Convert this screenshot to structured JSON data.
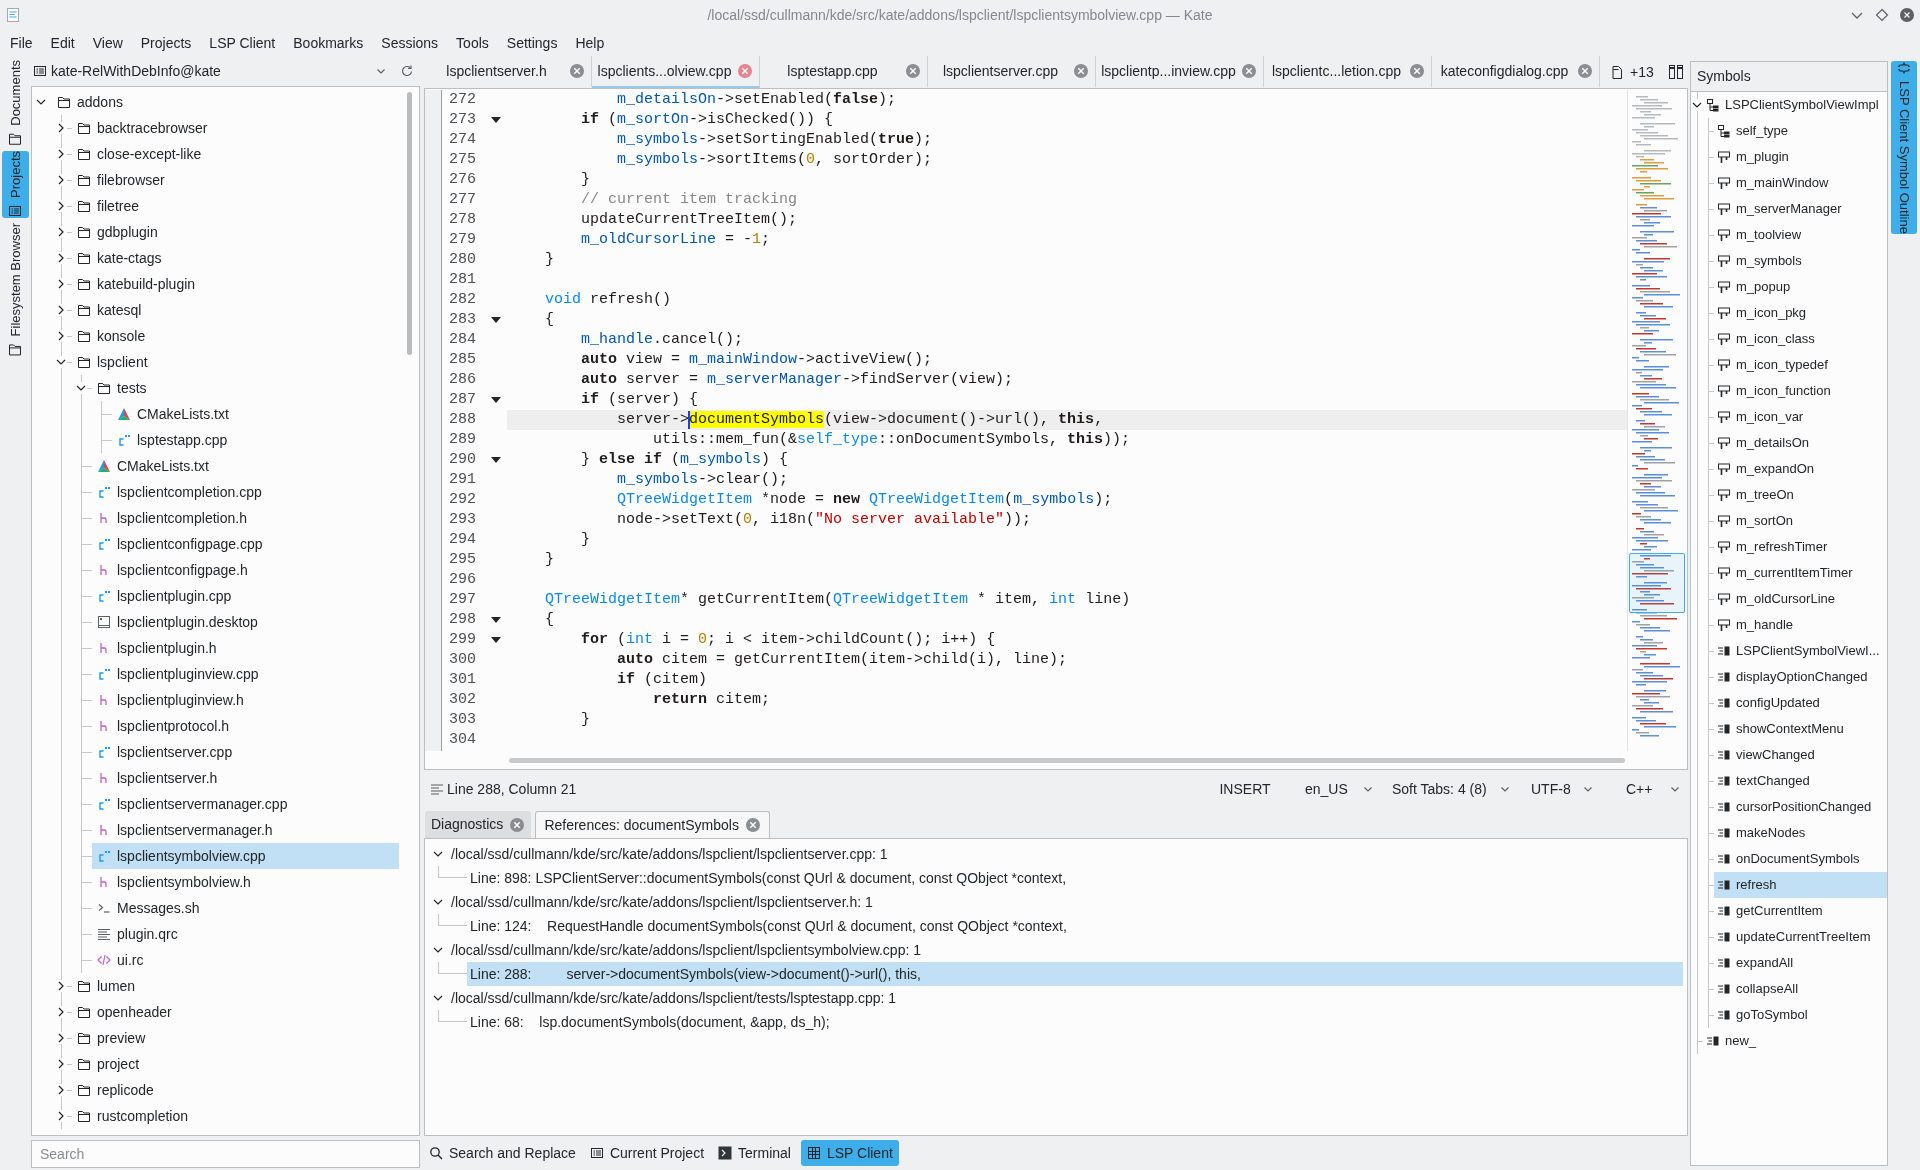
{
  "window": {
    "title": "/local/ssd/cullmann/kde/src/kate/addons/lspclient/lspclientsymbolview.cpp — Kate"
  },
  "menu_bar": [
    "File",
    "Edit",
    "View",
    "Projects",
    "LSP Client",
    "Bookmarks",
    "Sessions",
    "Tools",
    "Settings",
    "Help"
  ],
  "left_sidebar": [
    {
      "label": "Documents",
      "kind": "folder",
      "selected": false
    },
    {
      "label": "Projects",
      "kind": "list",
      "selected": true
    },
    {
      "label": "Filesystem Browser",
      "kind": "folder",
      "selected": false
    }
  ],
  "project_panel": {
    "project": "kate-RelWithDebInfo@kate",
    "tree": [
      {
        "label": "addons",
        "kind": "folder",
        "expanded": true,
        "selected": false,
        "children": [
          {
            "label": "backtracebrowser",
            "kind": "folder",
            "expanded": false,
            "selected": false
          },
          {
            "label": "close-except-like",
            "kind": "folder",
            "expanded": false,
            "selected": false
          },
          {
            "label": "filebrowser",
            "kind": "folder",
            "expanded": false,
            "selected": false
          },
          {
            "label": "filetree",
            "kind": "folder",
            "expanded": false,
            "selected": false
          },
          {
            "label": "gdbplugin",
            "kind": "folder",
            "expanded": false,
            "selected": false
          },
          {
            "label": "kate-ctags",
            "kind": "folder",
            "expanded": false,
            "selected": false
          },
          {
            "label": "katebuild-plugin",
            "kind": "folder",
            "expanded": false,
            "selected": false
          },
          {
            "label": "katesql",
            "kind": "folder",
            "expanded": false,
            "selected": false
          },
          {
            "label": "konsole",
            "kind": "folder",
            "expanded": false,
            "selected": false
          },
          {
            "label": "lspclient",
            "kind": "folder",
            "expanded": true,
            "selected": false,
            "children": [
              {
                "label": "tests",
                "kind": "folder",
                "expanded": true,
                "selected": false,
                "children": [
                  {
                    "label": "CMakeLists.txt",
                    "kind": "cmake",
                    "selected": false
                  },
                  {
                    "label": "lsptestapp.cpp",
                    "kind": "cpp",
                    "selected": false
                  }
                ]
              },
              {
                "label": "CMakeLists.txt",
                "kind": "cmake",
                "selected": false
              },
              {
                "label": "lspclientcompletion.cpp",
                "kind": "cpp",
                "selected": false
              },
              {
                "label": "lspclientcompletion.h",
                "kind": "header",
                "selected": false
              },
              {
                "label": "lspclientconfigpage.cpp",
                "kind": "cpp",
                "selected": false
              },
              {
                "label": "lspclientconfigpage.h",
                "kind": "header",
                "selected": false
              },
              {
                "label": "lspclientplugin.cpp",
                "kind": "cpp",
                "selected": false
              },
              {
                "label": "lspclientplugin.desktop",
                "kind": "desktop",
                "selected": false
              },
              {
                "label": "lspclientplugin.h",
                "kind": "header",
                "selected": false
              },
              {
                "label": "lspclientpluginview.cpp",
                "kind": "cpp",
                "selected": false
              },
              {
                "label": "lspclientpluginview.h",
                "kind": "header",
                "selected": false
              },
              {
                "label": "lspclientprotocol.h",
                "kind": "header",
                "selected": false
              },
              {
                "label": "lspclientserver.cpp",
                "kind": "cpp",
                "selected": false
              },
              {
                "label": "lspclientserver.h",
                "kind": "header",
                "selected": false
              },
              {
                "label": "lspclientservermanager.cpp",
                "kind": "cpp",
                "selected": false
              },
              {
                "label": "lspclientservermanager.h",
                "kind": "header",
                "selected": false
              },
              {
                "label": "lspclientsymbolview.cpp",
                "kind": "cpp",
                "selected": true
              },
              {
                "label": "lspclientsymbolview.h",
                "kind": "header",
                "selected": false
              },
              {
                "label": "Messages.sh",
                "kind": "shell",
                "selected": false
              },
              {
                "label": "plugin.qrc",
                "kind": "text",
                "selected": false
              },
              {
                "label": "ui.rc",
                "kind": "markup",
                "selected": false
              }
            ]
          },
          {
            "label": "lumen",
            "kind": "folder",
            "expanded": false,
            "selected": false
          },
          {
            "label": "openheader",
            "kind": "folder",
            "expanded": false,
            "selected": false
          },
          {
            "label": "preview",
            "kind": "folder",
            "expanded": false,
            "selected": false
          },
          {
            "label": "project",
            "kind": "folder",
            "expanded": false,
            "selected": false
          },
          {
            "label": "replicode",
            "kind": "folder",
            "expanded": false,
            "selected": false
          },
          {
            "label": "rustcompletion",
            "kind": "folder",
            "expanded": false,
            "selected": false
          }
        ]
      }
    ],
    "search": {
      "placeholder": "Search"
    }
  },
  "editor_tabs": [
    {
      "label": "lspclientserver.h",
      "selected": false
    },
    {
      "label": "lspclients...olview.cpp",
      "selected": true
    },
    {
      "label": "lsptestapp.cpp",
      "selected": false
    },
    {
      "label": "lspclientserver.cpp",
      "selected": false
    },
    {
      "label": "lspclientp...inview.cpp",
      "selected": false
    },
    {
      "label": "lspclientc...letion.cpp",
      "selected": false
    },
    {
      "label": "kateconfigdialog.cpp",
      "selected": false
    }
  ],
  "more_tabs": "+13",
  "editor": {
    "lines": [
      {
        "number": "272",
        "foldable": false,
        "current": false,
        "tokens": [
          {
            "kind": "member",
            "text": "            m_detailsOn"
          },
          {
            "kind": "plain",
            "text": "->setEnabled("
          },
          {
            "kind": "keyword",
            "text": "false"
          },
          {
            "kind": "plain",
            "text": ");"
          }
        ]
      },
      {
        "number": "273",
        "foldable": true,
        "current": false,
        "tokens": [
          {
            "kind": "keyword",
            "text": "        if"
          },
          {
            "kind": "plain",
            "text": " ("
          },
          {
            "kind": "member",
            "text": "m_sortOn"
          },
          {
            "kind": "plain",
            "text": "->isChecked()) {"
          }
        ]
      },
      {
        "number": "274",
        "foldable": false,
        "current": false,
        "tokens": [
          {
            "kind": "member",
            "text": "            m_symbols"
          },
          {
            "kind": "plain",
            "text": "->setSortingEnabled("
          },
          {
            "kind": "keyword",
            "text": "true"
          },
          {
            "kind": "plain",
            "text": ");"
          }
        ]
      },
      {
        "number": "275",
        "foldable": false,
        "current": false,
        "tokens": [
          {
            "kind": "member",
            "text": "            m_symbols"
          },
          {
            "kind": "plain",
            "text": "->sortItems("
          },
          {
            "kind": "number",
            "text": "0"
          },
          {
            "kind": "plain",
            "text": ", sortOrder);"
          }
        ]
      },
      {
        "number": "276",
        "foldable": false,
        "current": false,
        "tokens": [
          {
            "kind": "plain",
            "text": "        }"
          }
        ]
      },
      {
        "number": "277",
        "foldable": false,
        "current": false,
        "tokens": [
          {
            "kind": "comment",
            "text": "        // current item tracking"
          }
        ]
      },
      {
        "number": "278",
        "foldable": false,
        "current": false,
        "tokens": [
          {
            "kind": "plain",
            "text": "        updateCurrentTreeItem();"
          }
        ]
      },
      {
        "number": "279",
        "foldable": false,
        "current": false,
        "tokens": [
          {
            "kind": "member",
            "text": "        m_oldCursorLine"
          },
          {
            "kind": "plain",
            "text": " = -"
          },
          {
            "kind": "number",
            "text": "1"
          },
          {
            "kind": "plain",
            "text": ";"
          }
        ]
      },
      {
        "number": "280",
        "foldable": false,
        "current": false,
        "tokens": [
          {
            "kind": "plain",
            "text": "    }"
          }
        ]
      },
      {
        "number": "281",
        "foldable": false,
        "current": false
      },
      {
        "number": "282",
        "foldable": false,
        "current": false,
        "tokens": [
          {
            "kind": "type",
            "text": "    void"
          },
          {
            "kind": "plain",
            "text": " refresh()"
          }
        ]
      },
      {
        "number": "283",
        "foldable": true,
        "current": false,
        "tokens": [
          {
            "kind": "plain",
            "text": "    {"
          }
        ]
      },
      {
        "number": "284",
        "foldable": false,
        "current": false,
        "tokens": [
          {
            "kind": "member",
            "text": "        m_handle"
          },
          {
            "kind": "plain",
            "text": ".cancel();"
          }
        ]
      },
      {
        "number": "285",
        "foldable": false,
        "current": false,
        "tokens": [
          {
            "kind": "keyword",
            "text": "        auto"
          },
          {
            "kind": "plain",
            "text": " view = "
          },
          {
            "kind": "member",
            "text": "m_mainWindow"
          },
          {
            "kind": "plain",
            "text": "->activeView();"
          }
        ]
      },
      {
        "number": "286",
        "foldable": false,
        "current": false,
        "tokens": [
          {
            "kind": "keyword",
            "text": "        auto"
          },
          {
            "kind": "plain",
            "text": " server = "
          },
          {
            "kind": "member",
            "text": "m_serverManager"
          },
          {
            "kind": "plain",
            "text": "->findServer(view);"
          }
        ]
      },
      {
        "number": "287",
        "foldable": true,
        "current": false,
        "tokens": [
          {
            "kind": "keyword",
            "text": "        if"
          },
          {
            "kind": "plain",
            "text": " (server) {"
          }
        ]
      },
      {
        "number": "288",
        "foldable": false,
        "current": true,
        "tokens": [
          {
            "kind": "plain",
            "text": "            server->"
          },
          {
            "kind": "match",
            "text": "documentSymbols",
            "cursor": true
          },
          {
            "kind": "plain",
            "text": "(view->document()->url(), "
          },
          {
            "kind": "keyword",
            "text": "this"
          },
          {
            "kind": "plain",
            "text": ","
          }
        ]
      },
      {
        "number": "289",
        "foldable": false,
        "current": false,
        "tokens": [
          {
            "kind": "plain",
            "text": "                utils::mem_fun(&"
          },
          {
            "kind": "type",
            "text": "self_type"
          },
          {
            "kind": "plain",
            "text": "::onDocumentSymbols, "
          },
          {
            "kind": "keyword",
            "text": "this"
          },
          {
            "kind": "plain",
            "text": "));"
          }
        ]
      },
      {
        "number": "290",
        "foldable": true,
        "current": false,
        "tokens": [
          {
            "kind": "plain",
            "text": "        } "
          },
          {
            "kind": "keyword",
            "text": "else if"
          },
          {
            "kind": "plain",
            "text": " ("
          },
          {
            "kind": "member",
            "text": "m_symbols"
          },
          {
            "kind": "plain",
            "text": ") {"
          }
        ]
      },
      {
        "number": "291",
        "foldable": false,
        "current": false,
        "tokens": [
          {
            "kind": "member",
            "text": "            m_symbols"
          },
          {
            "kind": "plain",
            "text": "->clear();"
          }
        ]
      },
      {
        "number": "292",
        "foldable": false,
        "current": false,
        "tokens": [
          {
            "kind": "type",
            "text": "            QTreeWidgetItem"
          },
          {
            "kind": "plain",
            "text": " *node = "
          },
          {
            "kind": "keyword",
            "text": "new"
          },
          {
            "kind": "type",
            "text": " QTreeWidgetItem"
          },
          {
            "kind": "plain",
            "text": "("
          },
          {
            "kind": "member",
            "text": "m_symbols"
          },
          {
            "kind": "plain",
            "text": ");"
          }
        ]
      },
      {
        "number": "293",
        "foldable": false,
        "current": false,
        "tokens": [
          {
            "kind": "plain",
            "text": "            node->setText("
          },
          {
            "kind": "number",
            "text": "0"
          },
          {
            "kind": "plain",
            "text": ", i18n("
          },
          {
            "kind": "string",
            "text": "\"No server available\""
          },
          {
            "kind": "plain",
            "text": "));"
          }
        ]
      },
      {
        "number": "294",
        "foldable": false,
        "current": false,
        "tokens": [
          {
            "kind": "plain",
            "text": "        }"
          }
        ]
      },
      {
        "number": "295",
        "foldable": false,
        "current": false,
        "tokens": [
          {
            "kind": "plain",
            "text": "    }"
          }
        ]
      },
      {
        "number": "296",
        "foldable": false,
        "current": false
      },
      {
        "number": "297",
        "foldable": false,
        "current": false,
        "tokens": [
          {
            "kind": "type",
            "text": "    QTreeWidgetItem"
          },
          {
            "kind": "plain",
            "text": "* getCurrentItem("
          },
          {
            "kind": "type",
            "text": "QTreeWidgetItem"
          },
          {
            "kind": "plain",
            "text": " * item, "
          },
          {
            "kind": "type",
            "text": "int"
          },
          {
            "kind": "plain",
            "text": " line)"
          }
        ]
      },
      {
        "number": "298",
        "foldable": true,
        "current": false,
        "tokens": [
          {
            "kind": "plain",
            "text": "    {"
          }
        ]
      },
      {
        "number": "299",
        "foldable": true,
        "current": false,
        "tokens": [
          {
            "kind": "keyword",
            "text": "        for"
          },
          {
            "kind": "plain",
            "text": " ("
          },
          {
            "kind": "type",
            "text": "int"
          },
          {
            "kind": "plain",
            "text": " i = "
          },
          {
            "kind": "number",
            "text": "0"
          },
          {
            "kind": "plain",
            "text": "; i < item->childCount(); i++) {"
          }
        ]
      },
      {
        "number": "300",
        "foldable": false,
        "current": false,
        "tokens": [
          {
            "kind": "keyword",
            "text": "            auto"
          },
          {
            "kind": "plain",
            "text": " citem = getCurrentItem(item->child(i), line);"
          }
        ]
      },
      {
        "number": "301",
        "foldable": false,
        "current": false,
        "tokens": [
          {
            "kind": "keyword",
            "text": "            if"
          },
          {
            "kind": "plain",
            "text": " (citem)"
          }
        ]
      },
      {
        "number": "302",
        "foldable": false,
        "current": false,
        "tokens": [
          {
            "kind": "keyword",
            "text": "                return"
          },
          {
            "kind": "plain",
            "text": " citem;"
          }
        ]
      },
      {
        "number": "303",
        "foldable": false,
        "current": false,
        "tokens": [
          {
            "kind": "plain",
            "text": "        }"
          }
        ]
      },
      {
        "number": "304",
        "foldable": false,
        "current": false
      }
    ]
  },
  "status_bar": {
    "position": "Line 288, Column 21",
    "mode": "INSERT",
    "dropdowns": [
      "en_US",
      "Soft Tabs: 4 (8)",
      "UTF-8",
      "C++"
    ]
  },
  "bottom_panel": {
    "tabs": [
      {
        "label": "Diagnostics",
        "selected": false
      },
      {
        "label": "References: documentSymbols",
        "selected": true
      }
    ],
    "references": [
      {
        "file": "/local/ssd/cullmann/kde/src/kate/addons/lspclient/lspclientserver.cpp: 1",
        "expanded": true,
        "selected": false,
        "children": [
          {
            "text": "Line: 898: LSPClientServer::documentSymbols(const QUrl & document, const QObject *context,",
            "selected": false
          }
        ]
      },
      {
        "file": "/local/ssd/cullmann/kde/src/kate/addons/lspclient/lspclientserver.h: 1",
        "expanded": true,
        "selected": false,
        "children": [
          {
            "text": "Line: 124:    RequestHandle documentSymbols(const QUrl & document, const QObject *context,",
            "selected": false
          }
        ]
      },
      {
        "file": "/local/ssd/cullmann/kde/src/kate/addons/lspclient/lspclientsymbolview.cpp: 1",
        "expanded": true,
        "selected": false,
        "children": [
          {
            "text": "Line: 288:         server->documentSymbols(view->document()->url(), this,",
            "selected": true
          }
        ]
      },
      {
        "file": "/local/ssd/cullmann/kde/src/kate/addons/lspclient/tests/lsptestapp.cpp: 1",
        "expanded": true,
        "selected": false,
        "children": [
          {
            "text": "Line: 68:    lsp.documentSymbols(document, &app, ds_h);",
            "selected": false
          }
        ]
      }
    ]
  },
  "tool_views": [
    {
      "label": "Search and Replace",
      "kind": "search",
      "selected": false
    },
    {
      "label": "Current Project",
      "kind": "project",
      "selected": false
    },
    {
      "label": "Terminal",
      "kind": "terminal",
      "selected": false
    },
    {
      "label": "LSP Client",
      "kind": "lsp",
      "selected": true
    }
  ],
  "symbols_panel": {
    "title": "Symbols",
    "tree": [
      {
        "label": "LSPClientSymbolViewImpl",
        "kind": "class",
        "expanded": true,
        "selected": false,
        "children": [
          {
            "label": "self_type",
            "kind": "class",
            "selected": false
          },
          {
            "label": "m_plugin",
            "kind": "variable",
            "selected": false
          },
          {
            "label": "m_mainWindow",
            "kind": "variable",
            "selected": false
          },
          {
            "label": "m_serverManager",
            "kind": "variable",
            "selected": false
          },
          {
            "label": "m_toolview",
            "kind": "variable",
            "selected": false
          },
          {
            "label": "m_symbols",
            "kind": "variable",
            "selected": false
          },
          {
            "label": "m_popup",
            "kind": "variable",
            "selected": false
          },
          {
            "label": "m_icon_pkg",
            "kind": "variable",
            "selected": false
          },
          {
            "label": "m_icon_class",
            "kind": "variable",
            "selected": false
          },
          {
            "label": "m_icon_typedef",
            "kind": "variable",
            "selected": false
          },
          {
            "label": "m_icon_function",
            "kind": "variable",
            "selected": false
          },
          {
            "label": "m_icon_var",
            "kind": "variable",
            "selected": false
          },
          {
            "label": "m_detailsOn",
            "kind": "variable",
            "selected": false
          },
          {
            "label": "m_expandOn",
            "kind": "variable",
            "selected": false
          },
          {
            "label": "m_treeOn",
            "kind": "variable",
            "selected": false
          },
          {
            "label": "m_sortOn",
            "kind": "variable",
            "selected": false
          },
          {
            "label": "m_refreshTimer",
            "kind": "variable",
            "selected": false
          },
          {
            "label": "m_currentItemTimer",
            "kind": "variable",
            "selected": false
          },
          {
            "label": "m_oldCursorLine",
            "kind": "variable",
            "selected": false
          },
          {
            "label": "m_handle",
            "kind": "variable",
            "selected": false
          },
          {
            "label": "LSPClientSymbolViewI...",
            "kind": "function",
            "selected": false
          },
          {
            "label": "displayOptionChanged",
            "kind": "function",
            "selected": false
          },
          {
            "label": "configUpdated",
            "kind": "function",
            "selected": false
          },
          {
            "label": "showContextMenu",
            "kind": "function",
            "selected": false
          },
          {
            "label": "viewChanged",
            "kind": "function",
            "selected": false
          },
          {
            "label": "textChanged",
            "kind": "function",
            "selected": false
          },
          {
            "label": "cursorPositionChanged",
            "kind": "function",
            "selected": false
          },
          {
            "label": "makeNodes",
            "kind": "function",
            "selected": false
          },
          {
            "label": "onDocumentSymbols",
            "kind": "function",
            "selected": false
          },
          {
            "label": "refresh",
            "kind": "function",
            "selected": true
          },
          {
            "label": "getCurrentItem",
            "kind": "function",
            "selected": false
          },
          {
            "label": "updateCurrentTreeItem",
            "kind": "function",
            "selected": false
          },
          {
            "label": "expandAll",
            "kind": "function",
            "selected": false
          },
          {
            "label": "collapseAll",
            "kind": "function",
            "selected": false
          },
          {
            "label": "goToSymbol",
            "kind": "function",
            "selected": false
          }
        ]
      },
      {
        "label": "new_",
        "kind": "function",
        "selected": false
      }
    ]
  },
  "right_sidebar": [
    {
      "label": "LSP Client Symbol Outline",
      "kind": "outline",
      "selected": true
    }
  ]
}
